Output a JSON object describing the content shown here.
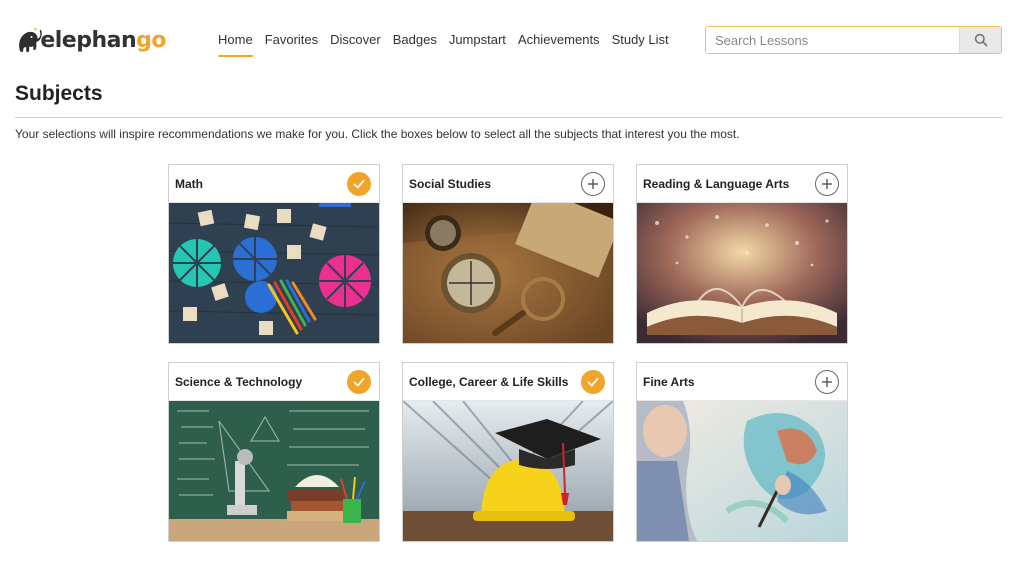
{
  "brand": {
    "name_main": "elephan",
    "name_accent": "go",
    "accent_color": "#f0a52a"
  },
  "nav": {
    "items": [
      {
        "label": "Home",
        "active": true
      },
      {
        "label": "Favorites",
        "active": false
      },
      {
        "label": "Discover",
        "active": false
      },
      {
        "label": "Badges",
        "active": false
      },
      {
        "label": "Jumpstart",
        "active": false
      },
      {
        "label": "Achievements",
        "active": false
      },
      {
        "label": "Study List",
        "active": false
      }
    ]
  },
  "search": {
    "placeholder": "Search Lessons",
    "value": "",
    "icon": "search-icon"
  },
  "page": {
    "title": "Subjects",
    "intro": "Your selections will inspire recommendations we make for you. Click the boxes below to select all the subjects that interest you the most."
  },
  "subjects": [
    {
      "title": "Math",
      "selected": true,
      "icon": "check-icon"
    },
    {
      "title": "Social Studies",
      "selected": false,
      "icon": "plus-icon"
    },
    {
      "title": "Reading & Language Arts",
      "selected": false,
      "icon": "plus-icon"
    },
    {
      "title": "Science & Technology",
      "selected": true,
      "icon": "check-icon"
    },
    {
      "title": "College, Career & Life Skills",
      "selected": true,
      "icon": "check-icon"
    },
    {
      "title": "Fine Arts",
      "selected": false,
      "icon": "plus-icon"
    }
  ]
}
